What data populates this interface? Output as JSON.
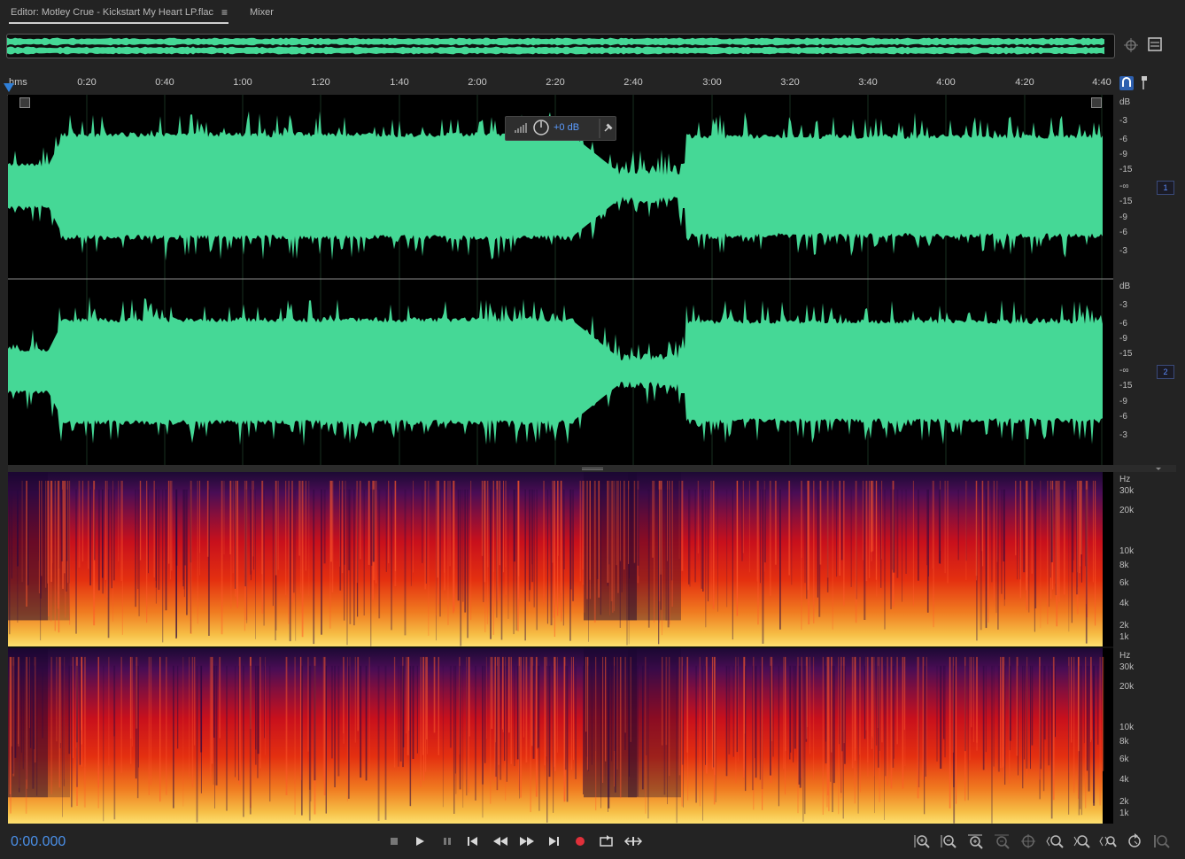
{
  "tabs": {
    "editor_label": "Editor: Motley Crue - Kickstart My Heart LP.flac",
    "editor_menu_icon": "≡",
    "mixer_label": "Mixer"
  },
  "ruler": {
    "unit": "hms",
    "ticks": [
      "0:20",
      "0:40",
      "1:00",
      "1:20",
      "1:40",
      "2:00",
      "2:20",
      "2:40",
      "3:00",
      "3:20",
      "3:40",
      "4:00",
      "4:20",
      "4:40"
    ]
  },
  "hud": {
    "value": "+0 dB"
  },
  "channels": [
    {
      "badge": "1",
      "db_labels": [
        "dB",
        "-3",
        "-6",
        "-9",
        "-15",
        "-∞",
        "-15",
        "-9",
        "-6",
        "-3"
      ]
    },
    {
      "badge": "2",
      "db_labels": [
        "dB",
        "-3",
        "-6",
        "-9",
        "-15",
        "-∞",
        "-15",
        "-9",
        "-6",
        "-3"
      ]
    }
  ],
  "spectral": {
    "hz_labels": [
      "Hz",
      "30k",
      "20k",
      "10k",
      "8k",
      "6k",
      "4k",
      "2k",
      "1k"
    ]
  },
  "transport": {
    "timecode": "0:00.000",
    "buttons": [
      "stop",
      "play",
      "pause",
      "go-to-start",
      "rewind",
      "fast-forward",
      "go-to-end",
      "record",
      "loop",
      "skip-selection"
    ]
  },
  "colors": {
    "waveform": "#45d896",
    "accent": "#2f7fd8",
    "record": "#e0303a"
  },
  "icons": [
    "menu-icon",
    "overview-zoom-icon",
    "overview-settings-icon",
    "snap-magnet-icon",
    "marker-pin-icon",
    "pin-icon",
    "knob-icon",
    "level-meter-icon"
  ]
}
